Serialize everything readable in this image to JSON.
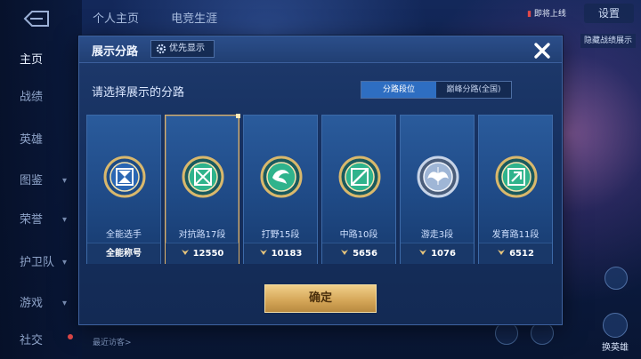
{
  "background": {
    "nav_items": [
      {
        "label": "主页"
      },
      {
        "label": "战绩"
      },
      {
        "label": "英雄"
      },
      {
        "label": "图鉴"
      },
      {
        "label": "荣誉"
      },
      {
        "label": "护卫队"
      },
      {
        "label": "游戏"
      },
      {
        "label": "社交"
      }
    ],
    "top_tabs": [
      "个人主页",
      "电竞生涯"
    ],
    "settings_label": "设置",
    "badge_text": "即将上线",
    "right_label": "隐藏战绩展示",
    "right_bottom_label": "换英雄",
    "visitors_label": "最近访客>"
  },
  "dialog": {
    "title": "展示分路",
    "priority_label": "优先显示",
    "prompt": "请选择展示的分路",
    "segments": [
      {
        "label": "分路段位",
        "active": true
      },
      {
        "label": "巅峰分路(全国)",
        "active": false
      }
    ],
    "cards": [
      {
        "name": "全能选手",
        "footer": "全能称号",
        "has_points": false,
        "selected": false,
        "emblem": "allround-emblem-icon"
      },
      {
        "name": "对抗路17段",
        "footer": "12550",
        "has_points": true,
        "selected": true,
        "emblem": "clash-lane-emblem-icon"
      },
      {
        "name": "打野15段",
        "footer": "10183",
        "has_points": true,
        "selected": false,
        "emblem": "jungle-emblem-icon"
      },
      {
        "name": "中路10段",
        "footer": "5656",
        "has_points": true,
        "selected": false,
        "emblem": "mid-lane-emblem-icon"
      },
      {
        "name": "游走3段",
        "footer": "1076",
        "has_points": true,
        "selected": false,
        "emblem": "roam-emblem-icon"
      },
      {
        "name": "发育路11段",
        "footer": "6512",
        "has_points": true,
        "selected": false,
        "emblem": "farm-lane-emblem-icon"
      }
    ],
    "confirm_label": "确定"
  },
  "colors": {
    "accent_gold": "#e0b36a",
    "segment_active": "#2e6ec2",
    "emblem_green": "#2fb38c",
    "emblem_silver": "#9fb6d6"
  }
}
